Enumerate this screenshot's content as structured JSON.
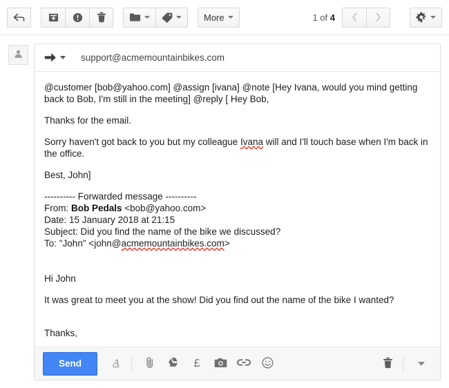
{
  "toolbar": {
    "back_icon": "reply-arrow-icon",
    "archive_icon": "archive-box-icon",
    "spam_icon": "report-spam-icon",
    "delete_icon": "trash-icon",
    "move_icon": "folder-icon",
    "labels_icon": "label-tag-icon",
    "more_label": "More",
    "pager_prefix": "1 of ",
    "pager_total": "4",
    "prev_icon": "chevron-left-icon",
    "next_icon": "chevron-right-icon",
    "settings_icon": "gear-icon"
  },
  "compose": {
    "avatar_icon": "person-avatar-icon",
    "forward_icon": "forward-arrow-icon",
    "to_address": "support@acmemountainbikes.com",
    "body": {
      "command_line": "@customer [bob@yahoo.com]  @assign [ivana]  @note [Hey Ivana, would you mind getting back to Bob, I'm still in the meeting]  @reply [ Hey Bob,",
      "para_thanks": "Thanks for the email.",
      "para_sorry_1": "Sorry haven't got back to you but my colleague ",
      "para_sorry_spell": "Ivana",
      "para_sorry_2": " will and I'll touch base when I'm back in the office.",
      "para_best": "Best, John]",
      "forwarded_header": "---------- Forwarded message ----------",
      "fwd_from_label": "From: ",
      "fwd_from_name": "Bob Pedals",
      "fwd_from_email": " <bob@yahoo.com>",
      "fwd_date": "Date: 15 January 2018 at 21:15",
      "fwd_subject": "Subject: Did you find the name of the bike we discussed?",
      "fwd_to_label": "To: \"John\" <john@",
      "fwd_to_spell": "acmemountainbikes.com",
      "fwd_to_end": ">",
      "quoted_greeting": "Hi John",
      "quoted_body": "It was great to meet you at the show! Did you find out the name of the bike I wanted?",
      "quoted_thanks": "Thanks,"
    },
    "footer": {
      "send_label": "Send",
      "format_icon": "text-format-icon",
      "attach_icon": "paperclip-icon",
      "drive_icon": "google-drive-icon",
      "money_icon": "pound-currency-icon",
      "photo_icon": "camera-icon",
      "link_icon": "link-chain-icon",
      "emoji_icon": "emoji-smiley-icon",
      "discard_icon": "trash-icon",
      "options_icon": "more-options-caret-icon"
    }
  },
  "colors": {
    "send_blue": "#4285f4",
    "spellcheck_red": "#ee3322"
  }
}
